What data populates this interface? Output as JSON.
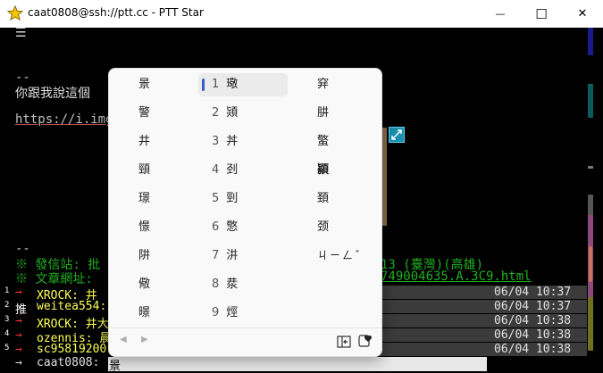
{
  "window": {
    "title": "caat0808@ssh://ptt.cc - PTT Star",
    "minimize_glyph": "—",
    "maximize_glyph": "☐",
    "close_glyph": "✕"
  },
  "terminal": {
    "menu_glyph": "☰",
    "sig_dashes": "--",
    "line_chat": "你跟我說這個",
    "line_link": "https://i.img",
    "sig_dashes2": "--",
    "sent_from": "※ 發信站: 批",
    "sent_from_tail": "13 (臺灣)(高雄)",
    "article_url": "※ 文章網址: ",
    "article_url_tail": "749004635.A.3C9.html",
    "prompt_arrow": "→",
    "prompt_user": "caat0808:",
    "prompt_input": "景"
  },
  "pushes": [
    {
      "num": "1",
      "tag": "→",
      "user": "XROCK: 井",
      "time": "06/04 10:37",
      "tag_color": "#ff3030"
    },
    {
      "num": "2",
      "tag": "推",
      "user": "weitea554:",
      "time": "06/04 10:37",
      "tag_color": "#ffffff"
    },
    {
      "num": "3",
      "tag": "→",
      "user": "XROCK: 井大",
      "time": "06/04 10:38",
      "tag_color": "#ff3030"
    },
    {
      "num": "4",
      "tag": "→",
      "user": "ozennis: 晨",
      "time": "06/04 10:38",
      "tag_color": "#ff3030"
    },
    {
      "num": "5",
      "tag": "→",
      "user": "sc95819200",
      "time": "06/04 10:38",
      "tag_color": "#ff3030"
    }
  ],
  "ime": {
    "left_column": [
      "景",
      "警",
      "井",
      "頸",
      "璟",
      "憬",
      "阱",
      "儆",
      "暻"
    ],
    "middle_column": [
      {
        "num": "1",
        "char": "璥"
      },
      {
        "num": "2",
        "char": "熲"
      },
      {
        "num": "3",
        "char": "丼"
      },
      {
        "num": "4",
        "char": "刭"
      },
      {
        "num": "5",
        "char": "剄"
      },
      {
        "num": "6",
        "char": "憼"
      },
      {
        "num": "7",
        "char": "汫"
      },
      {
        "num": "8",
        "char": "汬"
      },
      {
        "num": "9",
        "char": "烴"
      }
    ],
    "right_column": [
      "穽",
      "肼",
      "蟼",
      "顈",
      "頚",
      "颈"
    ],
    "bopomofo": "ㄐㄧㄥˇ",
    "prev_glyph": "◀",
    "next_glyph": "▶"
  },
  "colors": {
    "terminal_bg": "#000000",
    "ime_bg": "#f9f9f9",
    "highlight_accent": "#2f5fd0",
    "push_time_bg": "#3b3b3b",
    "green_text": "#20b020",
    "yellow_text": "#ffff55"
  }
}
